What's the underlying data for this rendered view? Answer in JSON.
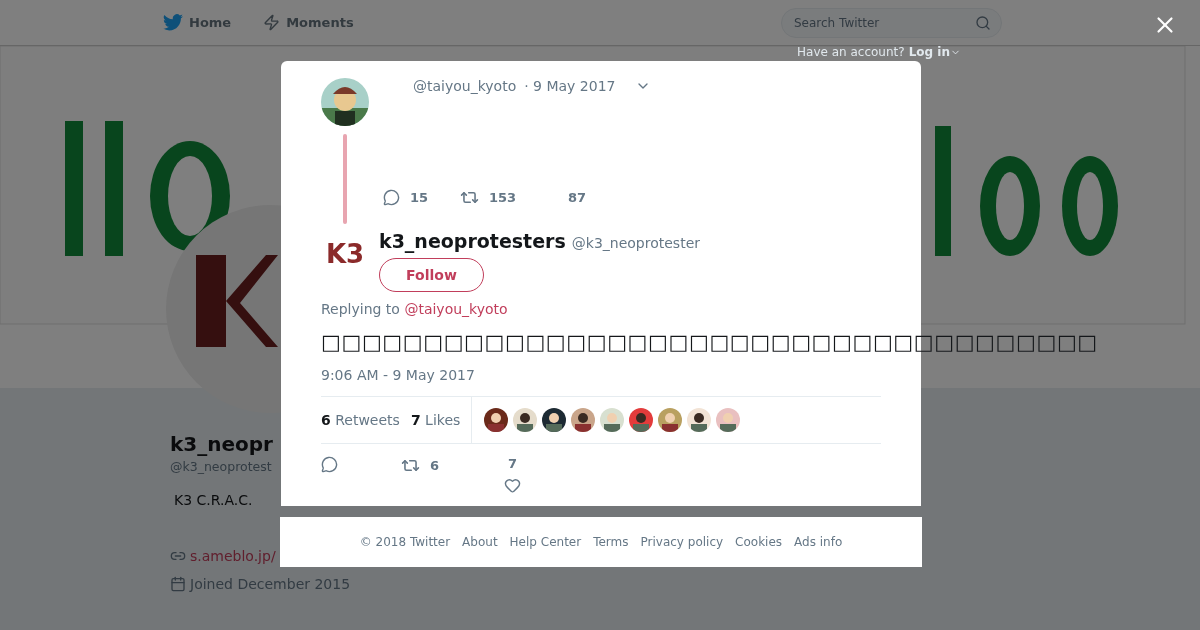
{
  "nav": {
    "items": [
      {
        "label": "Home",
        "kind": "home"
      },
      {
        "label": "Moments",
        "kind": "moments"
      }
    ],
    "search": {
      "placeholder": "Search Twitter"
    },
    "account_prompt": "Have an account?",
    "login": "Log in"
  },
  "profile": {
    "name": "k3_neopr",
    "handle": "@k3_neoprotest",
    "bio": "K3 C.R.A.C.",
    "link": "s.ameblo.jp/",
    "joined": "Joined December 2015"
  },
  "modal": {
    "parent_tweet": {
      "handle": "@taiyou_kyoto",
      "date": "· 9 May 2017",
      "replies": "15",
      "retweets": "153",
      "likes": "87"
    },
    "tweet": {
      "avatar_text": "K3",
      "name": "k3_neoprotesters",
      "handle": "@k3_neoprotester",
      "follow": "Follow",
      "replying_label": "Replying to",
      "replying_to": "@taiyou_kyoto",
      "text": "□□□□□□□□□□□□□□□□□□□□□□□□□□□□□□□□□□□□□□",
      "timestamp": "9:06 AM - 9 May 2017",
      "retweet_count": "6",
      "retweet_label": "Retweets",
      "like_count": "7",
      "like_label": "Likes",
      "actions": {
        "retweets": "6",
        "likes": "7"
      }
    }
  },
  "footer": [
    "© 2018 Twitter",
    "About",
    "Help Center",
    "Terms",
    "Privacy policy",
    "Cookies",
    "Ads info"
  ]
}
